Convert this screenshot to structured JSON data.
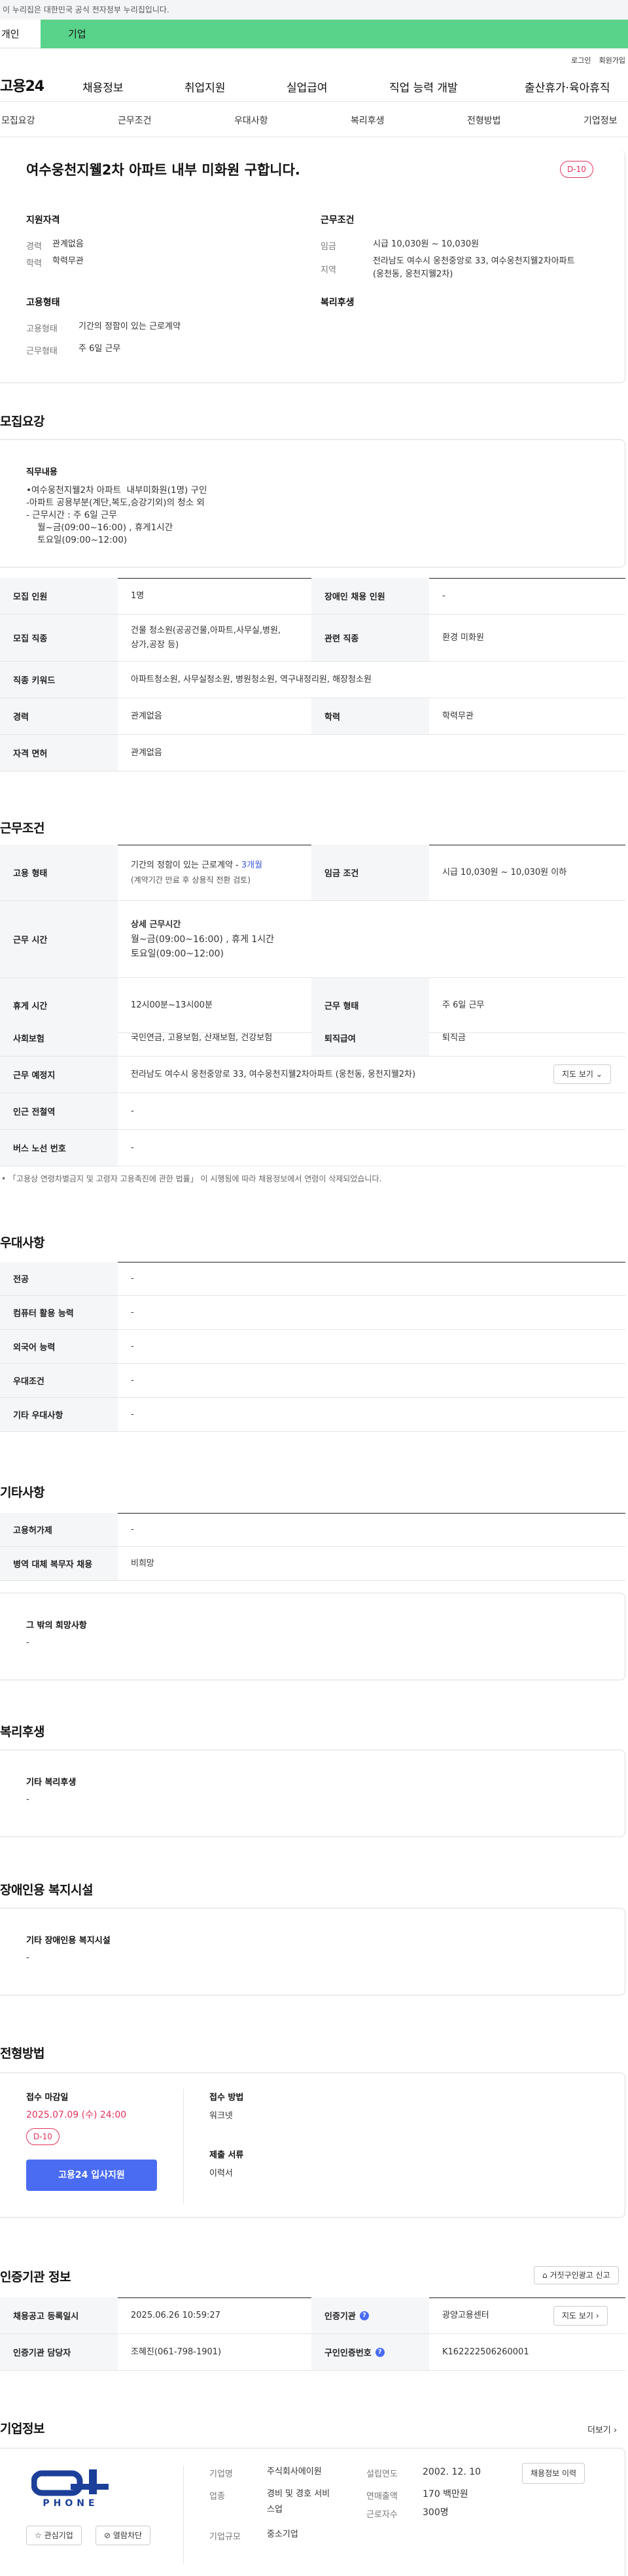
{
  "notice": "이 누리집은 대한민국 공식 전자정부 누리집입니다.",
  "top_tabs": [
    "개인",
    "기업"
  ],
  "utility": [
    "로그인",
    "회원가입"
  ],
  "logo": "고용24",
  "gnb": [
    "채용정보",
    "취업지원",
    "실업급여",
    "직업 능력 개발",
    "출산휴가·육아휴직"
  ],
  "anchors": [
    "모집요강",
    "근무조건",
    "우대사항",
    "복리후생",
    "전형방법",
    "기업정보"
  ],
  "summary": {
    "title": "여수웅천지웰2차 아파트 내부 미화원 구합니다.",
    "dday": "D-10",
    "qual_head": "지원자격",
    "career_k": "경력",
    "career_v": "관계없음",
    "edu_k": "학력",
    "edu_v": "학력무관",
    "emp_head": "고용형태",
    "emp_k": "고용형태",
    "emp_v": "기간의 정함이 있는 근로계약",
    "work_k": "근무형태",
    "work_v": "주 6일 근무",
    "cond_head": "근무조건",
    "wage_k": "임금",
    "wage_v": "시급 10,030원 ~ 10,030원",
    "region_k": "지역",
    "region_v": "전라남도 여수시 웅천중앙로 33, 여수웅천지웰2차아파트 (웅천동, 웅천지웰2차)",
    "welfare_head": "복리후생"
  },
  "recruit": {
    "title": "모집요강",
    "duty_head": "직무내용",
    "duty_text": "•여수웅천지웰2차 아파트  내부미화원(1명) 구인\n-아파트 공용부분(계단,복도,승강기외)의 청소 외\n- 근무시간 : 주 6일 근무\n    월~금(09:00~16:00) , 휴게1시간\n    토요일(09:00~12:00)",
    "rows": {
      "headcount_k": "모집 인원",
      "headcount_v": "1명",
      "disabled_k": "장애인 채용 인원",
      "disabled_v": "-",
      "job_k": "모집 직종",
      "job_v1": "건물 청소원(공공건물,아파트,사무실,병원,",
      "job_v2": "상가,공장 등)",
      "related_k": "관련 직종",
      "related_v": "환경 미화원",
      "kw_k": "직종 키워드",
      "kw_v": "아파트청소원, 사무실청소원, 병원청소원, 역구내정리원, 해장청소원",
      "career_k": "경력",
      "career_v": "관계없음",
      "edu_k": "학력",
      "edu_v": "학력무관",
      "license_k": "자격 면허",
      "license_v": "관계없음"
    }
  },
  "conditions": {
    "title": "근무조건",
    "emp_k": "고용 형태",
    "emp_v1": "기간의 정함이 있는 근로계약 - ",
    "emp_months": "3개월",
    "emp_v2": "(계약기간 만료 후 상용직 전환 검토)",
    "wage_k": "임금 조건",
    "wage_v": "시급 10,030원 ~ 10,030원 이하",
    "hours_k": "근무 시간",
    "hours_head": "상세 근무시간",
    "hours_v1": "월~금(09:00~16:00) , 휴게 1시간",
    "hours_v2": "토요일(09:00~12:00)",
    "break_k": "휴게 시간",
    "break_v": "12시00분~13시00분",
    "type_k": "근무 형태",
    "type_v": "주 6일 근무",
    "ins_k": "사회보험",
    "ins_v": "국민연금, 고용보험, 산재보험, 건강보험",
    "severance_k": "퇴직급여",
    "severance_v": "퇴직금",
    "place_k": "근무 예정지",
    "place_v": "전라남도 여수시 웅천중앙로 33, 여수웅천지웰2차아파트 (웅천동, 웅천지웰2차)",
    "map_btn": "지도 보기",
    "subway_k": "인근 전철역",
    "subway_v": "-",
    "bus_k": "버스 노선 번호",
    "bus_v": "-",
    "note": "「고용상 연령차별금지 및 고령자 고용촉진에 관한 법률」 이 시행됨에 따라 채용정보에서 연령이 삭제되었습니다."
  },
  "preference": {
    "title": "우대사항",
    "rows": [
      {
        "k": "전공",
        "v": "-"
      },
      {
        "k": "컴퓨터 활용 능력",
        "v": "-"
      },
      {
        "k": "외국어 능력",
        "v": "-"
      },
      {
        "k": "우대조건",
        "v": "-"
      },
      {
        "k": "기타 우대사항",
        "v": "-"
      }
    ]
  },
  "etc": {
    "title": "기타사항",
    "rows": [
      {
        "k": "고용허가제",
        "v": "-"
      },
      {
        "k": "병역 대체 복무자 채용",
        "v": "비희망"
      }
    ],
    "other_head": "그 밖의 희망사항",
    "other_v": "-"
  },
  "welfare": {
    "title": "복리후생",
    "head": "기타 복리후생",
    "v": "-"
  },
  "disabled_facility": {
    "title": "장애인용 복지시설",
    "head": "기타 장애인용 복지시설",
    "v": "-"
  },
  "selection": {
    "title": "전형방법",
    "deadline_head": "접수 마감일",
    "deadline": "2025.07.09 (수) 24:00",
    "dday": "D-10",
    "apply_btn": "고용24 입사지원",
    "method_head": "접수 방법",
    "method_v": "워크넷",
    "docs_head": "제출 서류",
    "docs_v": "이력서"
  },
  "cert": {
    "title": "인증기관 정보",
    "report_btn": "거짓구인광고 신고",
    "reg_k": "채용공고 등록일시",
    "reg_v": "2025.06.26 10:59:27",
    "agency_k": "인증기관",
    "agency_v": "광양고용센터",
    "map_btn": "지도 보기",
    "manager_k": "인증기관 담당자",
    "manager_v": "조혜진(061-798-1901)",
    "jobno_k": "구인인증번호",
    "jobno_v": "K162222506260001"
  },
  "company": {
    "title": "기업정보",
    "more": "더보기",
    "logo_text": "PHONE",
    "fav_btn": "관심기업",
    "block_btn": "열람차단",
    "name_k": "기업명",
    "name_v": "주식회사에이원",
    "industry_k": "업종",
    "industry_v1": "경비 및 경호 서비",
    "industry_v2": "스업",
    "size_k": "기업규모",
    "size_v": "중소기업",
    "founded_k": "설립연도",
    "founded_v": "2002. 12. 10",
    "sales_k": "연매출액",
    "sales_v": "170 백만원",
    "employees_k": "근로자수",
    "employees_v": "300명",
    "history_btn": "채용정보 이력"
  }
}
